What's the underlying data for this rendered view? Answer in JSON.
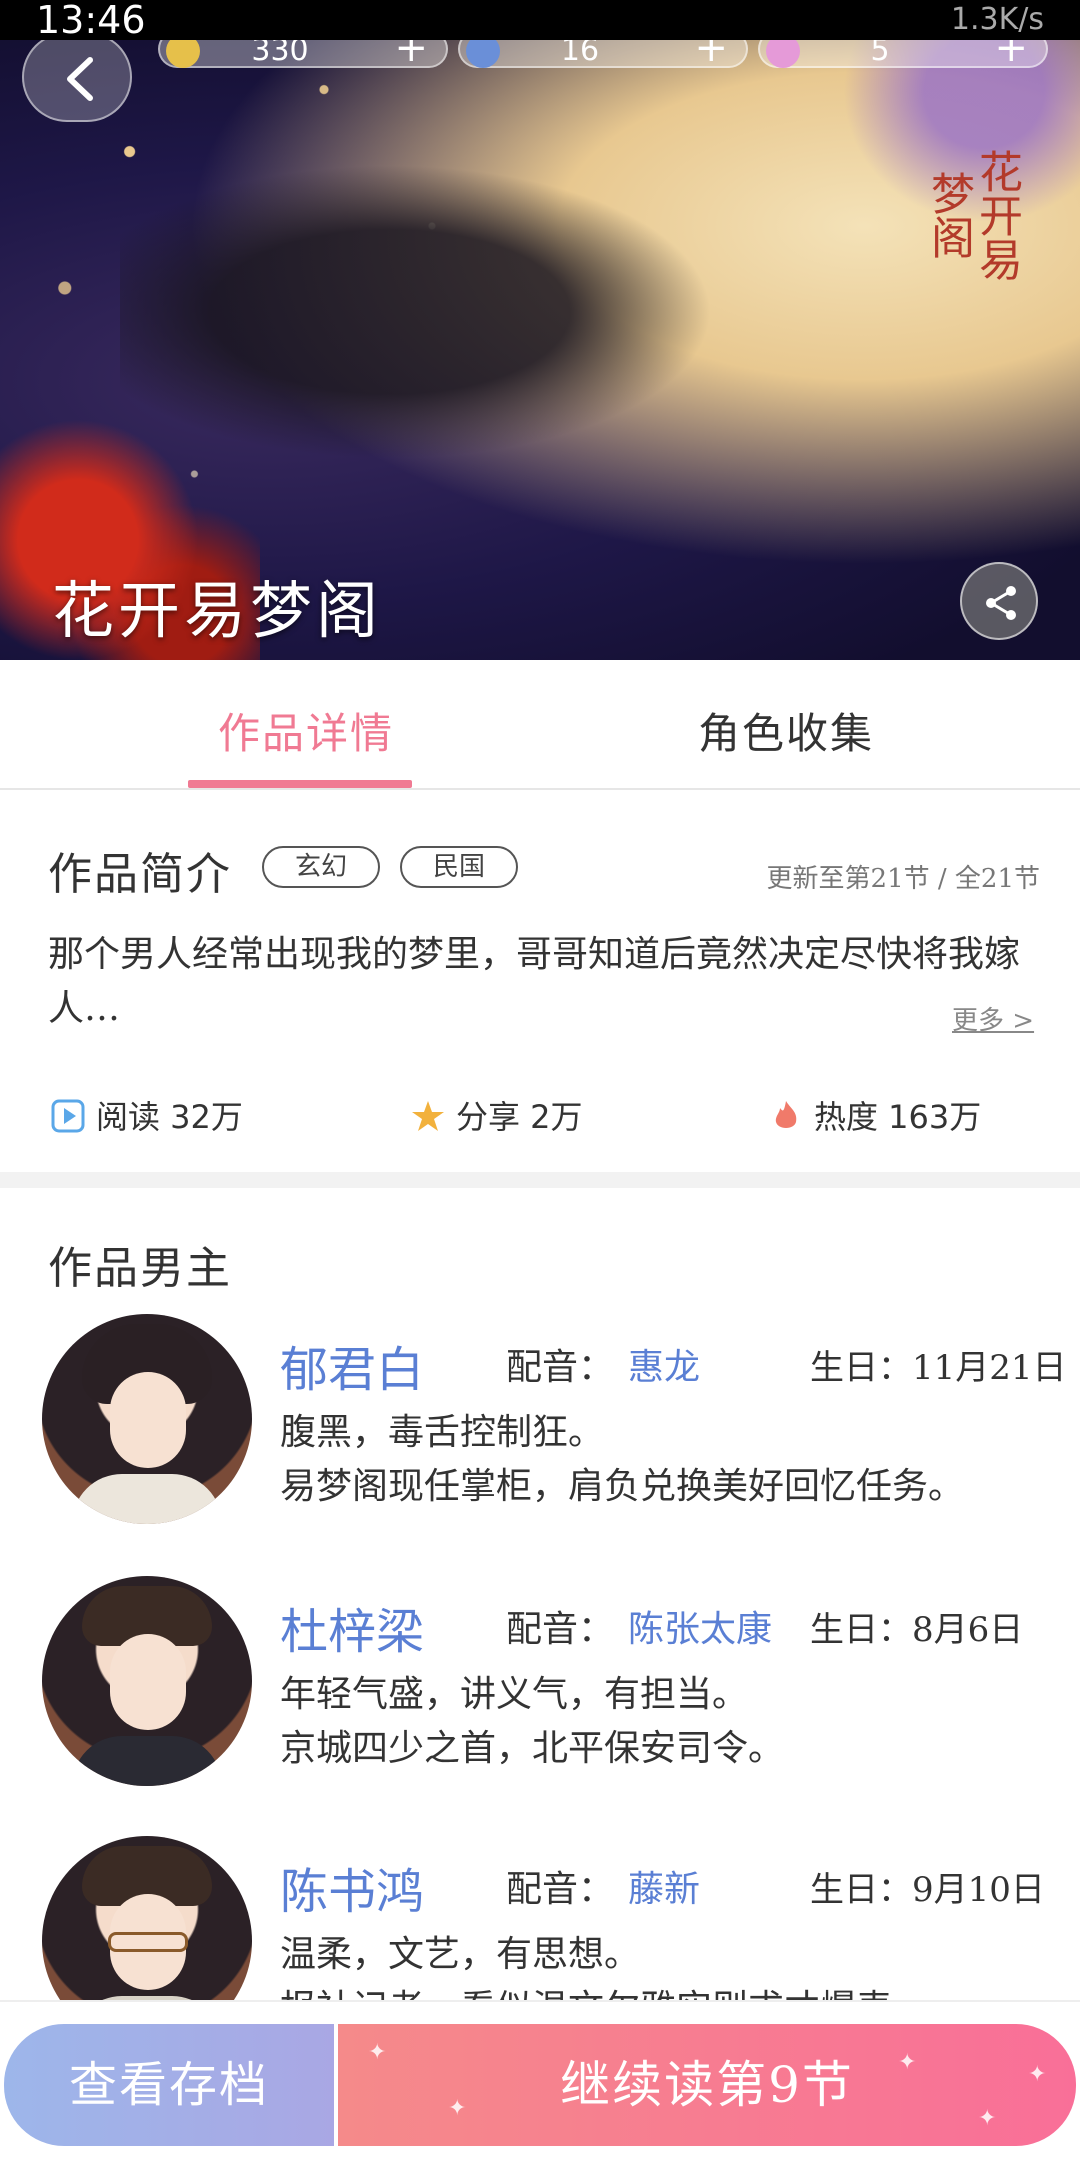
{
  "status_bar": {
    "time": "13:46",
    "network": "1.3K/s"
  },
  "header": {
    "resources": [
      {
        "icon": "coin-icon",
        "value": "330"
      },
      {
        "icon": "ticket-icon",
        "value": "16"
      },
      {
        "icon": "diamond-icon",
        "value": "5"
      }
    ],
    "title": "花开易梦阁",
    "logo_text": "花开易梦阁"
  },
  "tabs": [
    {
      "label": "作品详情",
      "active": true
    },
    {
      "label": "角色收集",
      "active": false
    }
  ],
  "intro": {
    "heading": "作品简介",
    "tags": [
      "玄幻",
      "民国"
    ],
    "update": "更新至第21节 / 全21节",
    "text": "那个男人经常出现我的梦里，哥哥知道后竟然决定尽快将我嫁人…",
    "more": "更多 >"
  },
  "stats": {
    "read": "阅读 32万",
    "share": "分享 2万",
    "heat": "热度 163万"
  },
  "male_leads": {
    "heading": "作品男主",
    "va_label": "配音：",
    "characters": [
      {
        "name": "郁君白",
        "voice_actor": "惠龙",
        "birthday": "生日：11月21日",
        "desc_line1": "腹黑，毒舌控制狂。",
        "desc_line2": "易梦阁现任掌柜，肩负兑换美好回忆任务。"
      },
      {
        "name": "杜梓梁",
        "voice_actor": "陈张太康",
        "birthday": "生日：8月6日",
        "desc_line1": "年轻气盛，讲义气，有担当。",
        "desc_line2": "京城四少之首，北平保安司令。"
      },
      {
        "name": "陈书鸿",
        "voice_actor": "藤新",
        "birthday": "生日：9月10日",
        "desc_line1": "温柔，文艺，有思想。",
        "desc_line2": "报社记者，看似温文尔雅实则求才爆表"
      }
    ]
  },
  "bottom": {
    "save_label": "查看存档",
    "continue_label": "继续读第9节"
  },
  "colors": {
    "accent_pink": "#f07a93",
    "name_blue": "#5a7fd4",
    "save_gradient": [
      "#9db6ea",
      "#a9a7e4"
    ],
    "continue_gradient": [
      "#f58a8a",
      "#f96f98"
    ]
  }
}
